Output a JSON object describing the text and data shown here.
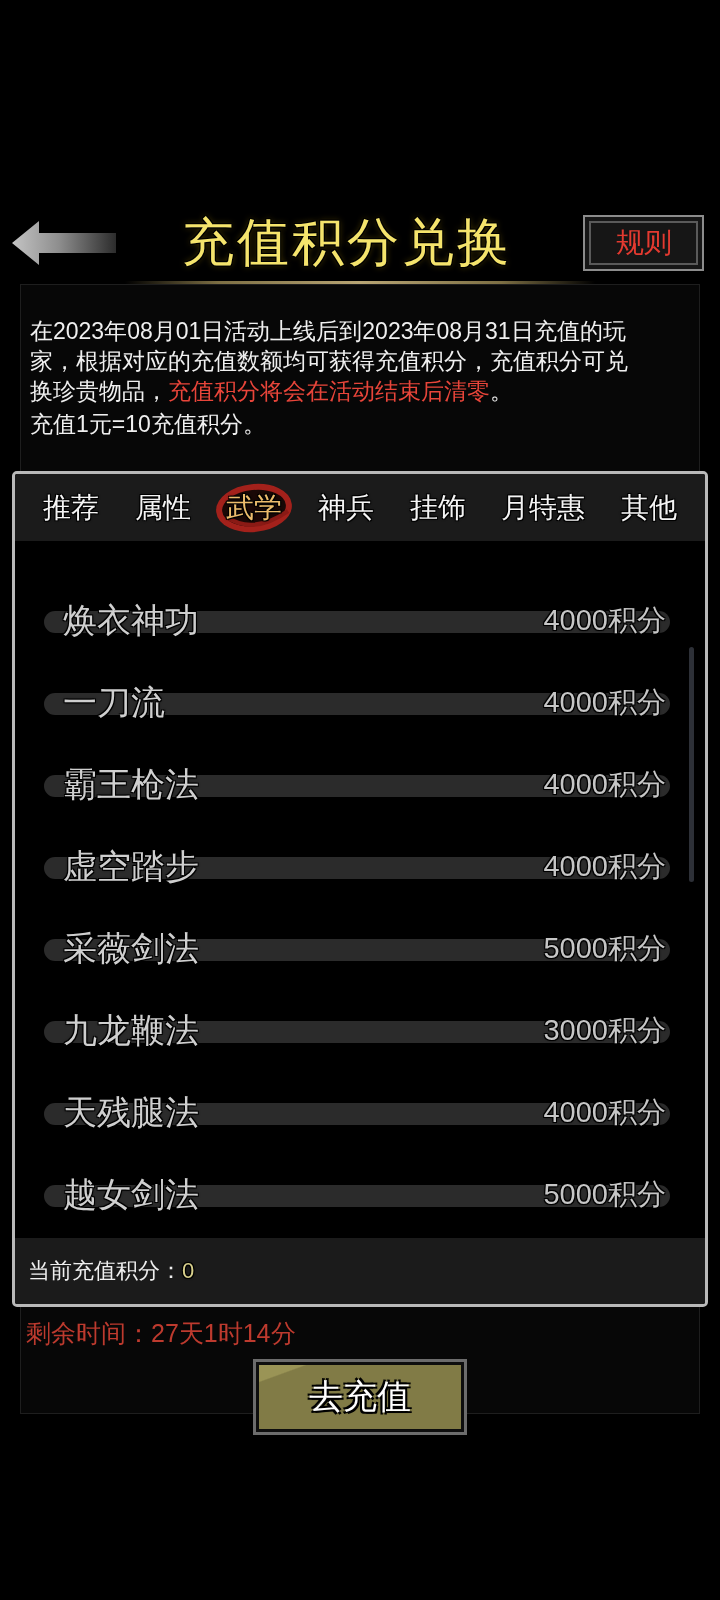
{
  "header": {
    "title": "充值积分兑换",
    "rules_button": "规则"
  },
  "description": {
    "segments": [
      {
        "text": "在2023年08月01日活动上线后到2023年08月31日充值的玩家，根据对应的充值数额均可获得充值积分，充值积分可兑换珍贵物品，",
        "highlight": false
      },
      {
        "text": "充值积分将会在活动结束后清零",
        "highlight": true
      },
      {
        "text": "。",
        "highlight": false
      }
    ],
    "rate_note": "充值1元=10充值积分。"
  },
  "exchange": {
    "tabs": [
      {
        "label": "推荐",
        "selected": false
      },
      {
        "label": "属性",
        "selected": false
      },
      {
        "label": "武学",
        "selected": true
      },
      {
        "label": "神兵",
        "selected": false
      },
      {
        "label": "挂饰",
        "selected": false
      },
      {
        "label": "月特惠",
        "selected": false
      },
      {
        "label": "其他",
        "selected": false
      }
    ],
    "items": [
      {
        "name": "焕衣神功",
        "cost": "4000积分"
      },
      {
        "name": "一刀流",
        "cost": "4000积分"
      },
      {
        "name": "霸王枪法",
        "cost": "4000积分"
      },
      {
        "name": "虚空踏步",
        "cost": "4000积分"
      },
      {
        "name": "采薇剑法",
        "cost": "5000积分"
      },
      {
        "name": "九龙鞭法",
        "cost": "3000积分"
      },
      {
        "name": "天残腿法",
        "cost": "4000积分"
      },
      {
        "name": "越女剑法",
        "cost": "5000积分"
      }
    ],
    "balance_label": "当前充值积分：",
    "balance_value": "0"
  },
  "remaining_time": "剩余时间：27天1时14分",
  "recharge_button": "去充值"
}
